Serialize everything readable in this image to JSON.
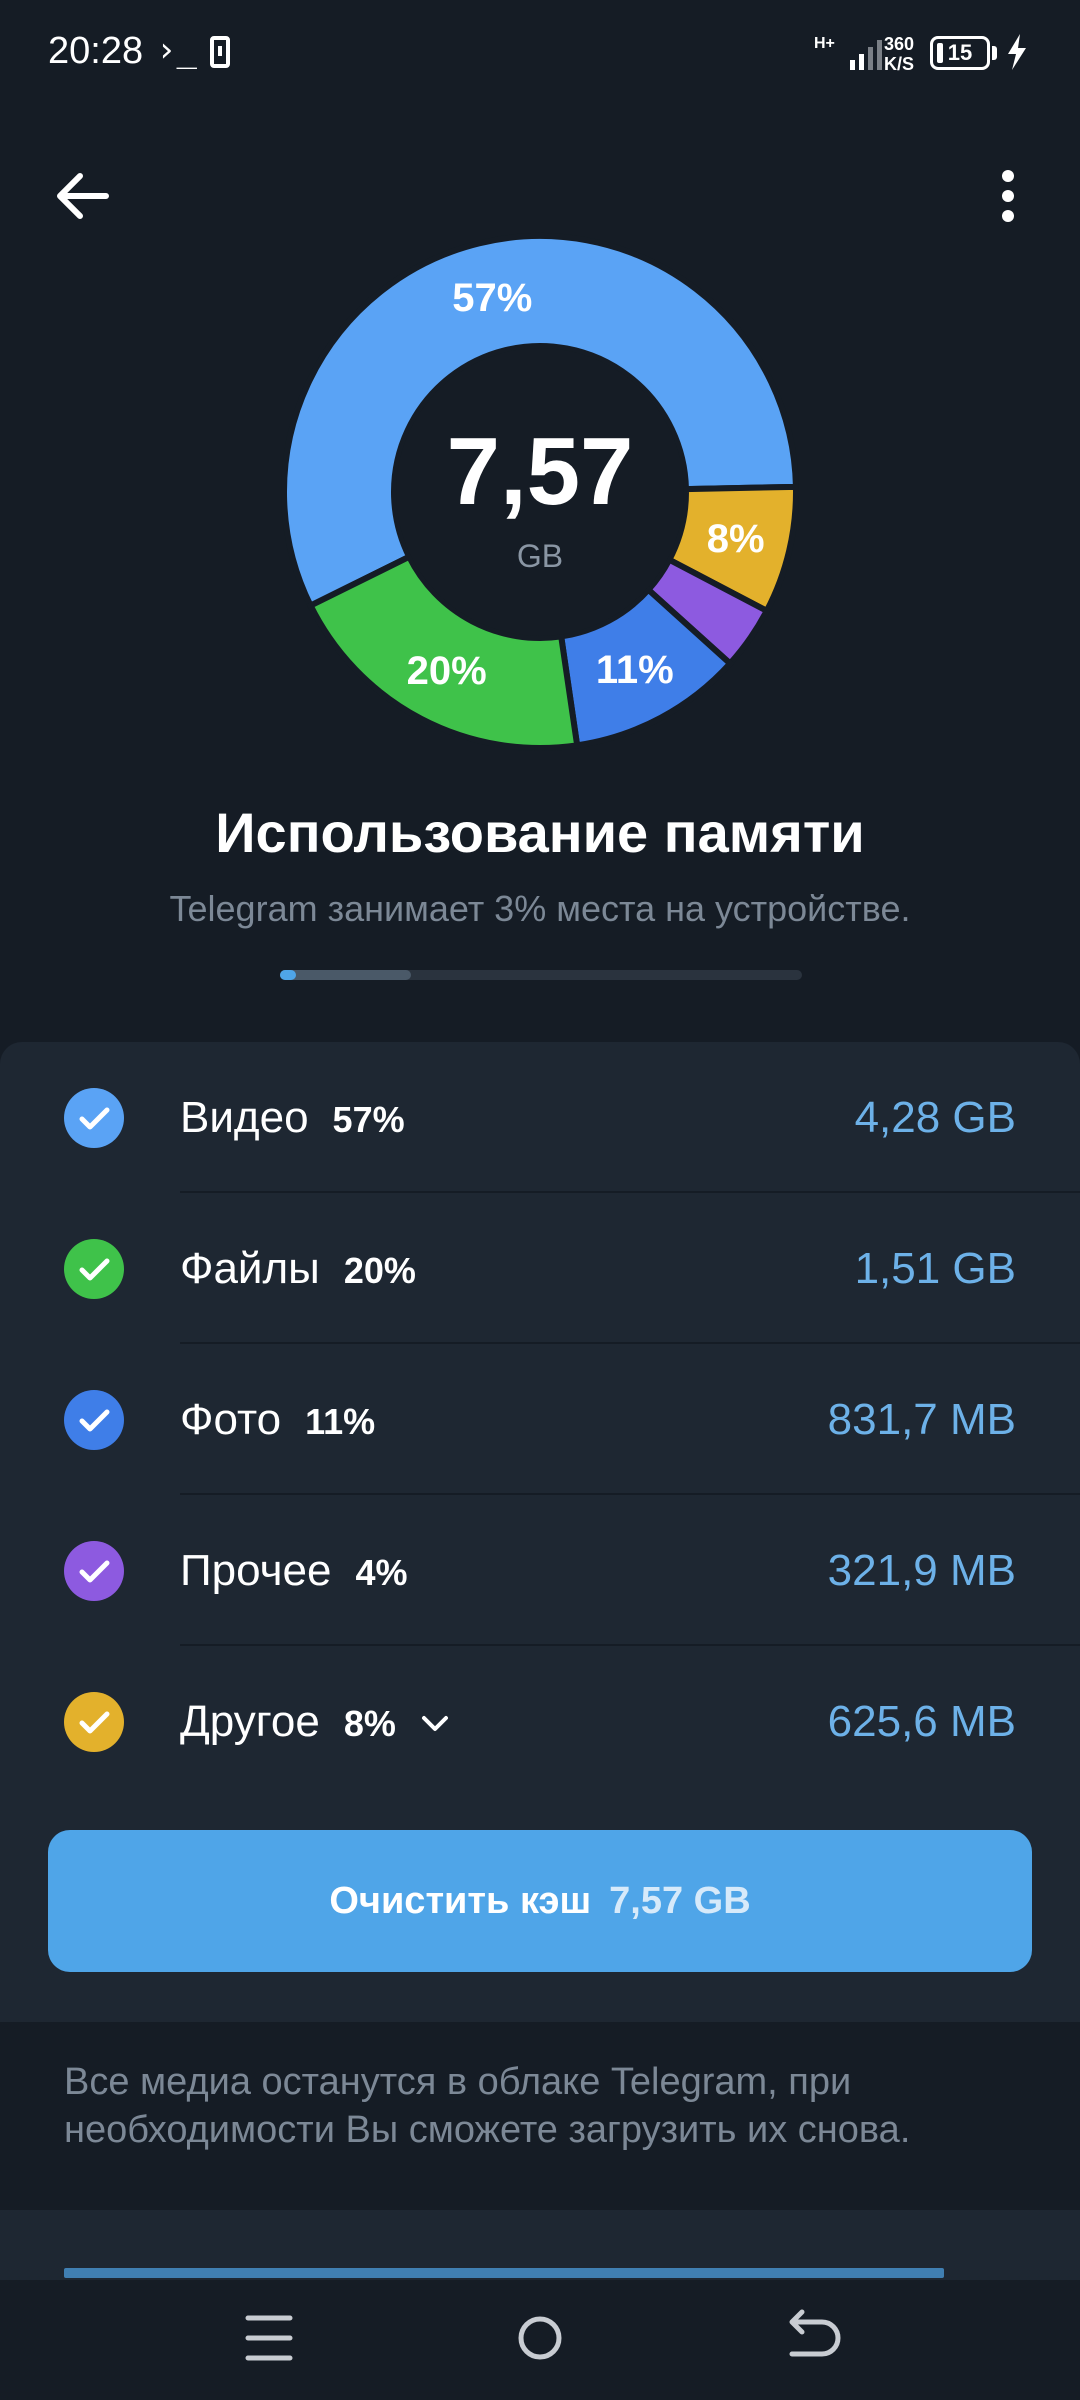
{
  "status_bar": {
    "time": "20:28",
    "terminal_glyph": "›_",
    "network": "H+",
    "speed_value": "360",
    "speed_unit": "K/S",
    "battery": "15"
  },
  "colors": {
    "video": "#5aa3f5",
    "files": "#3fc24a",
    "photo": "#3f7ee8",
    "other": "#8d5ae0",
    "misc": "#e3b12c",
    "accent": "#4fa5e8"
  },
  "chart_data": {
    "type": "pie",
    "center_value": "7,57",
    "center_unit": "GB",
    "slices": [
      {
        "label": "Видео",
        "percent": 57,
        "display": "57%",
        "color": "#5aa3f5"
      },
      {
        "label": "Другое",
        "percent": 8,
        "display": "8%",
        "color": "#e3b12c"
      },
      {
        "label": "Прочее",
        "percent": 4,
        "display": "",
        "color": "#8d5ae0"
      },
      {
        "label": "Фото",
        "percent": 11,
        "display": "11%",
        "color": "#3f7ee8"
      },
      {
        "label": "Файлы",
        "percent": 20,
        "display": "20%",
        "color": "#3fc24a"
      }
    ]
  },
  "title": "Использование памяти",
  "subtitle": "Telegram занимает 3% места на устройстве.",
  "usage_bar": {
    "telegram_fraction": 0.03,
    "used_fraction": 0.25
  },
  "rows": [
    {
      "label": "Видео",
      "percent": "57%",
      "size": "4,28 GB",
      "color": "#5aa3f5",
      "checked": true,
      "expandable": false
    },
    {
      "label": "Файлы",
      "percent": "20%",
      "size": "1,51 GB",
      "color": "#3fc24a",
      "checked": true,
      "expandable": false
    },
    {
      "label": "Фото",
      "percent": "11%",
      "size": "831,7 MB",
      "color": "#3f7ee8",
      "checked": true,
      "expandable": false
    },
    {
      "label": "Прочее",
      "percent": "4%",
      "size": "321,9 MB",
      "color": "#8d5ae0",
      "checked": true,
      "expandable": false
    },
    {
      "label": "Другое",
      "percent": "8%",
      "size": "625,6 MB",
      "color": "#e3b12c",
      "checked": true,
      "expandable": true
    }
  ],
  "clear_button": {
    "label": "Очистить кэш",
    "size": "7,57 GB"
  },
  "info_text": "Все медиа останутся в облаке Telegram, при необходимости Вы сможете загрузить их снова.",
  "icons": {
    "back": "arrow-left-icon",
    "more": "more-vertical-icon",
    "check": "check-icon",
    "chevron": "chevron-down-icon",
    "nav_menu": "menu-icon",
    "nav_home": "home-circle-icon",
    "nav_back": "back-arrow-icon"
  }
}
